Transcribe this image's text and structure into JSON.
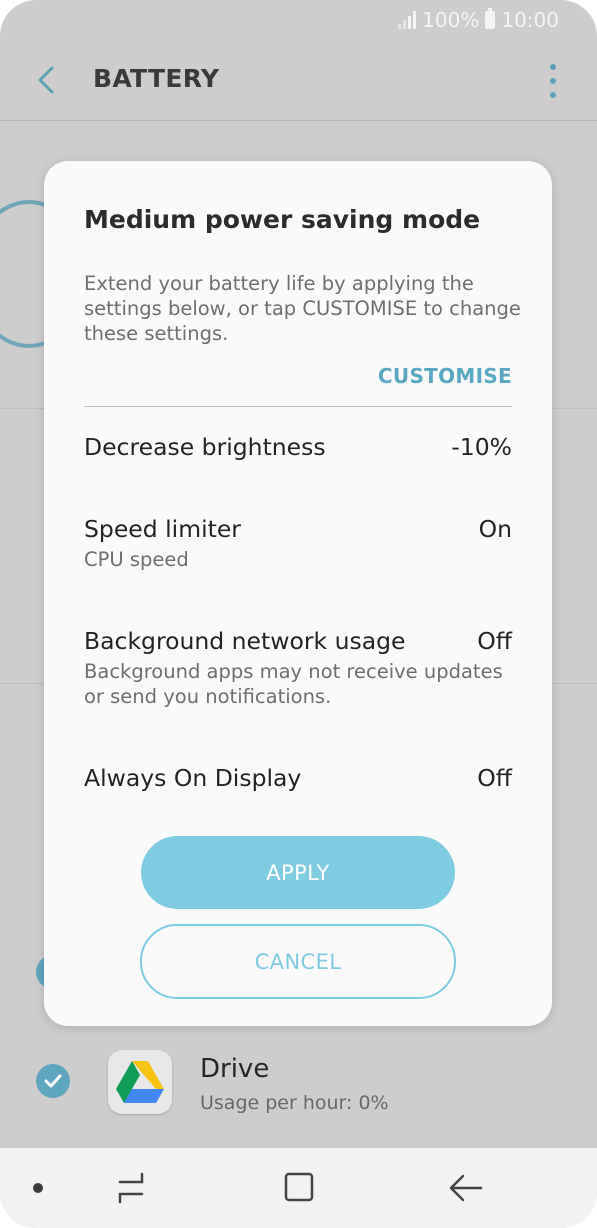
{
  "status": {
    "battery": "100%",
    "time": "10:00",
    "signal_icon": "signal-icon",
    "battery_icon": "battery-icon"
  },
  "appbar": {
    "title": "BATTERY",
    "back_icon": "arrow-back-icon",
    "more_icon": "more-vertical-icon"
  },
  "background": {
    "app_row": {
      "name": "Drive",
      "usage": "Usage per hour: 0%",
      "icon": "google-drive-icon"
    }
  },
  "dialog": {
    "title": "Medium power saving mode",
    "description": "Extend your battery life by applying the settings below, or tap CUSTOMISE to change these settings.",
    "customise_label": "CUSTOMISE",
    "settings": [
      {
        "label": "Decrease brightness",
        "value": "-10%",
        "sub": ""
      },
      {
        "label": "Speed limiter",
        "value": "On",
        "sub": "CPU speed"
      },
      {
        "label": "Background network usage",
        "value": "Off",
        "sub": "Background apps may not receive updates or send you notifications."
      },
      {
        "label": "Always On Display",
        "value": "Off",
        "sub": ""
      }
    ],
    "apply_label": "APPLY",
    "cancel_label": "CANCEL"
  },
  "colors": {
    "accent": "#7ecbe2",
    "link": "#5aa7c3",
    "scrim": "#cdcdcd"
  }
}
